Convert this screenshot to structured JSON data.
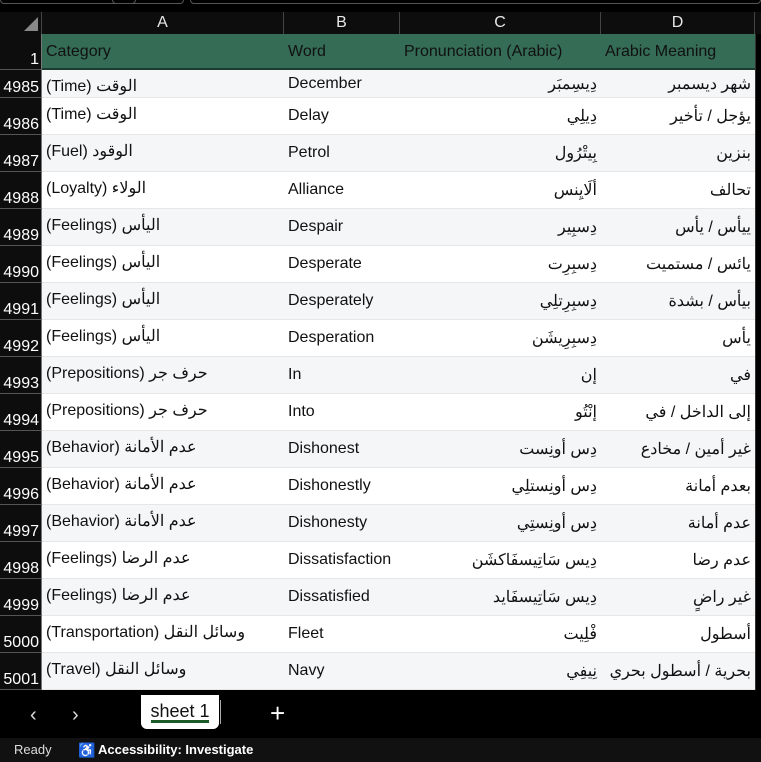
{
  "columns": [
    "A",
    "B",
    "C",
    "D"
  ],
  "header": {
    "row": "1",
    "category": "Category",
    "word": "Word",
    "pronunciation": "Pronunciation (Arabic)",
    "meaning": "Arabic Meaning"
  },
  "rows": [
    {
      "n": "4985",
      "category": "(Time) الوقت",
      "word": "December",
      "pron": "دِيسِمبَر",
      "meaning": "شهر ديسمبر"
    },
    {
      "n": "4986",
      "category": "(Time) الوقت",
      "word": "Delay",
      "pron": "دِيلِي",
      "meaning": "يؤجل / تأخير"
    },
    {
      "n": "4987",
      "category": "(Fuel) الوقود",
      "word": "Petrol",
      "pron": "بِيتْرُول",
      "meaning": "بنزين"
    },
    {
      "n": "4988",
      "category": "(Loyalty) الولاء",
      "word": "Alliance",
      "pron": "ألَايِنس",
      "meaning": "تحالف"
    },
    {
      "n": "4989",
      "category": "(Feelings) اليأس",
      "word": "Despair",
      "pron": "دِسبِير",
      "meaning": "ييأس / يأس"
    },
    {
      "n": "4990",
      "category": "(Feelings) اليأس",
      "word": "Desperate",
      "pron": "دِسبِرِت",
      "meaning": "يائس / مستميت"
    },
    {
      "n": "4991",
      "category": "(Feelings) اليأس",
      "word": "Desperately",
      "pron": "دِسبِرِتلِي",
      "meaning": "بيأس / بشدة"
    },
    {
      "n": "4992",
      "category": "(Feelings) اليأس",
      "word": "Desperation",
      "pron": "دِسبِرِيشَن",
      "meaning": "يأس"
    },
    {
      "n": "4993",
      "category": "(Prepositions) حرف جر",
      "word": "In",
      "pron": "إن",
      "meaning": "في"
    },
    {
      "n": "4994",
      "category": "(Prepositions) حرف جر",
      "word": "Into",
      "pron": "إنْتُو",
      "meaning": "إلى الداخل / في"
    },
    {
      "n": "4995",
      "category": "(Behavior) عدم الأمانة",
      "word": "Dishonest",
      "pron": "دِس أونِست",
      "meaning": "غير أمين / مخادع"
    },
    {
      "n": "4996",
      "category": "(Behavior) عدم الأمانة",
      "word": "Dishonestly",
      "pron": "دِس أونِستلِي",
      "meaning": "بعدم أمانة"
    },
    {
      "n": "4997",
      "category": "(Behavior) عدم الأمانة",
      "word": "Dishonesty",
      "pron": "دِس أونِستِي",
      "meaning": "عدم أمانة"
    },
    {
      "n": "4998",
      "category": "(Feelings) عدم الرضا",
      "word": "Dissatisfaction",
      "pron": "دِيس سَاتِيسفَاكشَن",
      "meaning": "عدم رضا"
    },
    {
      "n": "4999",
      "category": "(Feelings) عدم الرضا",
      "word": "Dissatisfied",
      "pron": "دِيس سَاتِيسفَايد",
      "meaning": "غير راضٍ"
    },
    {
      "n": "5000",
      "category": "(Transportation) وسائل النقل",
      "word": "Fleet",
      "pron": "فْلِيت",
      "meaning": "أسطول"
    },
    {
      "n": "5001",
      "category": "(Travel) وسائل النقل",
      "word": "Navy",
      "pron": "نِيفِي",
      "meaning": "بحرية / أسطول بحري"
    }
  ],
  "tabs": {
    "sheet": "sheet 1",
    "add": "+",
    "prev": "‹",
    "next": "›"
  },
  "status": {
    "ready": "Ready",
    "accessibility": "Accessibility: Investigate"
  },
  "colors": {
    "header_fill": "#346c55",
    "tab_underline": "#1c5a2a"
  }
}
